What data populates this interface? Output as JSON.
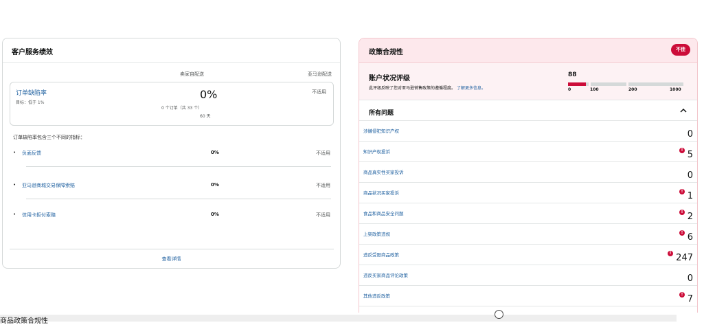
{
  "customer_service": {
    "title": "客户服务绩效",
    "col_seller": "卖家自配送",
    "col_amazon": "亚马逊配送",
    "odr": {
      "label": "订单缺陷率",
      "target": "目标：低于 1%",
      "value": "0%",
      "orders": "0 个订单（共 33 个）",
      "days": "60 天",
      "amazon_value": "不适用"
    },
    "metrics_intro": "订单缺陷率包含三个不同的指标：",
    "metrics": [
      {
        "bullet": "•",
        "label": "负面反馈",
        "value": "0%",
        "amazon_value": "不适用"
      },
      {
        "bullet": "•",
        "label": "亚马逊商城交易保障索赔",
        "value": "0%",
        "amazon_value": "不适用"
      },
      {
        "bullet": "•",
        "label": "信用卡拒付索赔",
        "value": "0%",
        "amazon_value": "不适用"
      }
    ],
    "see_details": "查看详情"
  },
  "policy": {
    "title": "政策合规性",
    "badge": "不佳",
    "ahr": {
      "title": "账户状况评级",
      "description": "此评级反映了您对亚马逊销售政策的遵循程度。",
      "learn_more": "了解更多信息。",
      "score": "88",
      "score_fraction": 0.88,
      "scale": [
        "0",
        "100",
        "200",
        "1000"
      ]
    },
    "issues_title": "所有问题",
    "issues": [
      {
        "label": "涉嫌侵犯知识产权",
        "count": "0",
        "alert": false
      },
      {
        "label": "知识产权投诉",
        "count": "5",
        "alert": true
      },
      {
        "label": "商品真实性买家投诉",
        "count": "0",
        "alert": false
      },
      {
        "label": "商品状况买家投诉",
        "count": "1",
        "alert": true
      },
      {
        "label": "食品和商品安全问题",
        "count": "2",
        "alert": true
      },
      {
        "label": "上架政策违规",
        "count": "6",
        "alert": true
      },
      {
        "label": "违反受限商品政策",
        "count": "247",
        "alert": true
      },
      {
        "label": "违反买家商品评论政策",
        "count": "0",
        "alert": false
      },
      {
        "label": "其他违反政策",
        "count": "7",
        "alert": true
      }
    ]
  },
  "bottom_bar": {
    "text": "商品政策合规性"
  },
  "colors": {
    "alert": "#cc0c39",
    "link": "#2162a1",
    "policy_bg": "#fde8ec"
  }
}
